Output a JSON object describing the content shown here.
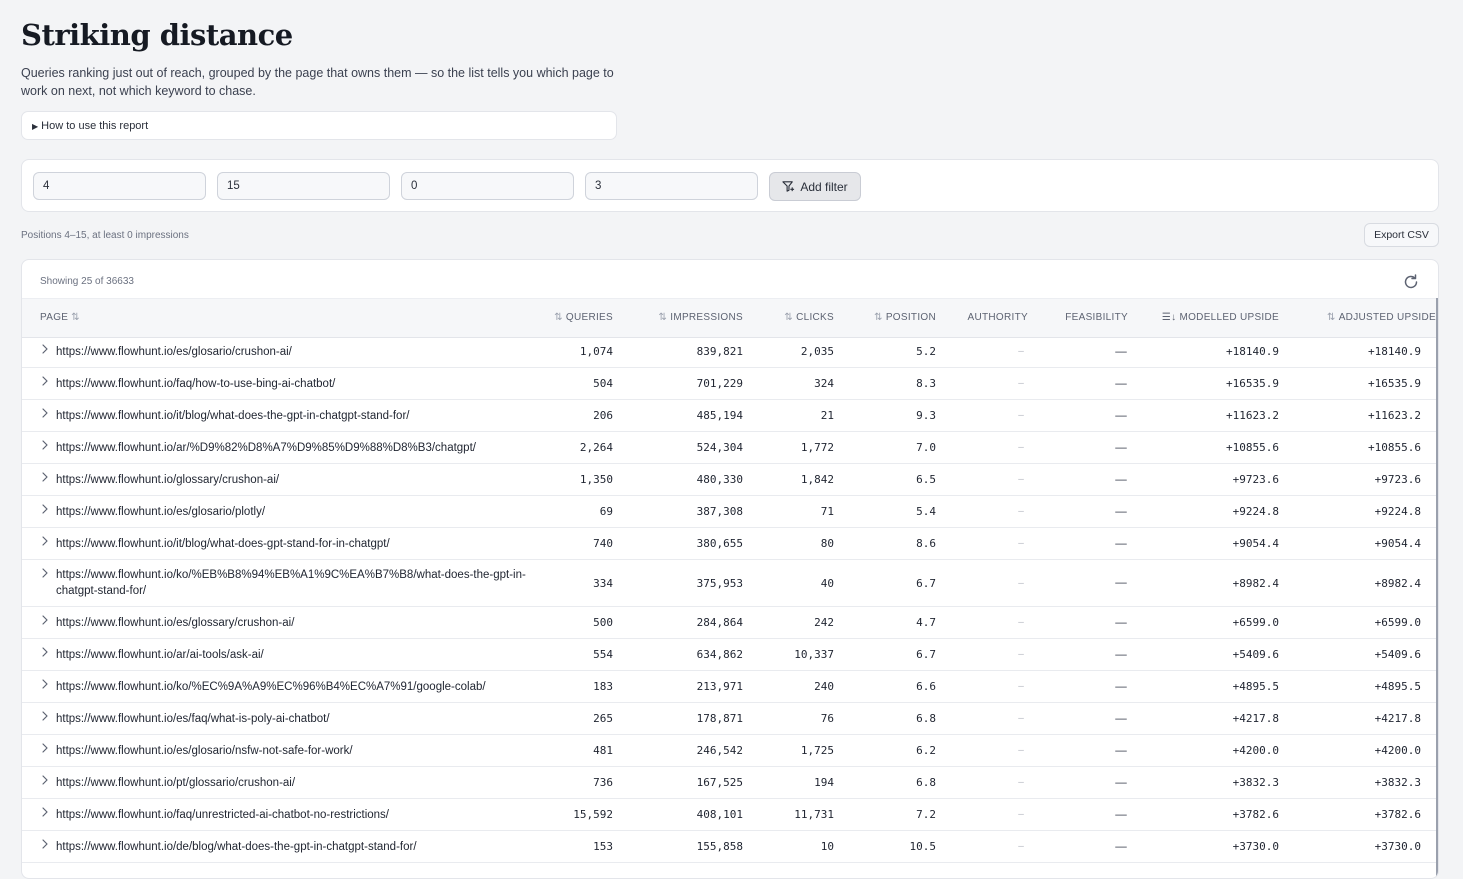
{
  "header": {
    "title": "Striking distance",
    "subtitle": "Queries ranking just out of reach, grouped by the page that owns them — so the list tells you which page to work on next, not which keyword to chase.",
    "howto_label": "How to use this report"
  },
  "filters": {
    "inputs": [
      "4",
      "15",
      "0",
      "3"
    ],
    "add_filter_label": "Add filter"
  },
  "caption": "Positions 4–15, at least 0 impressions",
  "export_label": "Export CSV",
  "table": {
    "showing": "Showing 25 of 36633",
    "columns": [
      "PAGE",
      "QUERIES",
      "IMPRESSIONS",
      "CLICKS",
      "POSITION",
      "AUTHORITY",
      "FEASIBILITY",
      "MODELLED UPSIDE",
      "ADJUSTED UPSIDE"
    ],
    "rows": [
      {
        "page": "https://www.flowhunt.io/es/glosario/crushon-ai/",
        "queries": "1,074",
        "impressions": "839,821",
        "clicks": "2,035",
        "position": "5.2",
        "authority": "–",
        "feasibility": "—",
        "modelled": "+18140.9",
        "adjusted": "+18140.9"
      },
      {
        "page": "https://www.flowhunt.io/faq/how-to-use-bing-ai-chatbot/",
        "queries": "504",
        "impressions": "701,229",
        "clicks": "324",
        "position": "8.3",
        "authority": "–",
        "feasibility": "—",
        "modelled": "+16535.9",
        "adjusted": "+16535.9"
      },
      {
        "page": "https://www.flowhunt.io/it/blog/what-does-the-gpt-in-chatgpt-stand-for/",
        "queries": "206",
        "impressions": "485,194",
        "clicks": "21",
        "position": "9.3",
        "authority": "–",
        "feasibility": "—",
        "modelled": "+11623.2",
        "adjusted": "+11623.2"
      },
      {
        "page": "https://www.flowhunt.io/ar/%D9%82%D8%A7%D9%85%D9%88%D8%B3/chatgpt/",
        "queries": "2,264",
        "impressions": "524,304",
        "clicks": "1,772",
        "position": "7.0",
        "authority": "–",
        "feasibility": "—",
        "modelled": "+10855.6",
        "adjusted": "+10855.6"
      },
      {
        "page": "https://www.flowhunt.io/glossary/crushon-ai/",
        "queries": "1,350",
        "impressions": "480,330",
        "clicks": "1,842",
        "position": "6.5",
        "authority": "–",
        "feasibility": "—",
        "modelled": "+9723.6",
        "adjusted": "+9723.6"
      },
      {
        "page": "https://www.flowhunt.io/es/glosario/plotly/",
        "queries": "69",
        "impressions": "387,308",
        "clicks": "71",
        "position": "5.4",
        "authority": "–",
        "feasibility": "—",
        "modelled": "+9224.8",
        "adjusted": "+9224.8"
      },
      {
        "page": "https://www.flowhunt.io/it/blog/what-does-gpt-stand-for-in-chatgpt/",
        "queries": "740",
        "impressions": "380,655",
        "clicks": "80",
        "position": "8.6",
        "authority": "–",
        "feasibility": "—",
        "modelled": "+9054.4",
        "adjusted": "+9054.4"
      },
      {
        "page": "https://www.flowhunt.io/ko/%EB%B8%94%EB%A1%9C%EA%B7%B8/what-does-the-gpt-in-chatgpt-stand-for/",
        "queries": "334",
        "impressions": "375,953",
        "clicks": "40",
        "position": "6.7",
        "authority": "–",
        "feasibility": "—",
        "modelled": "+8982.4",
        "adjusted": "+8982.4"
      },
      {
        "page": "https://www.flowhunt.io/es/glossary/crushon-ai/",
        "queries": "500",
        "impressions": "284,864",
        "clicks": "242",
        "position": "4.7",
        "authority": "–",
        "feasibility": "—",
        "modelled": "+6599.0",
        "adjusted": "+6599.0"
      },
      {
        "page": "https://www.flowhunt.io/ar/ai-tools/ask-ai/",
        "queries": "554",
        "impressions": "634,862",
        "clicks": "10,337",
        "position": "6.7",
        "authority": "–",
        "feasibility": "—",
        "modelled": "+5409.6",
        "adjusted": "+5409.6"
      },
      {
        "page": "https://www.flowhunt.io/ko/%EC%9A%A9%EC%96%B4%EC%A7%91/google-colab/",
        "queries": "183",
        "impressions": "213,971",
        "clicks": "240",
        "position": "6.6",
        "authority": "–",
        "feasibility": "—",
        "modelled": "+4895.5",
        "adjusted": "+4895.5"
      },
      {
        "page": "https://www.flowhunt.io/es/faq/what-is-poly-ai-chatbot/",
        "queries": "265",
        "impressions": "178,871",
        "clicks": "76",
        "position": "6.8",
        "authority": "–",
        "feasibility": "—",
        "modelled": "+4217.8",
        "adjusted": "+4217.8"
      },
      {
        "page": "https://www.flowhunt.io/es/glosario/nsfw-not-safe-for-work/",
        "queries": "481",
        "impressions": "246,542",
        "clicks": "1,725",
        "position": "6.2",
        "authority": "–",
        "feasibility": "—",
        "modelled": "+4200.0",
        "adjusted": "+4200.0"
      },
      {
        "page": "https://www.flowhunt.io/pt/glossario/crushon-ai/",
        "queries": "736",
        "impressions": "167,525",
        "clicks": "194",
        "position": "6.8",
        "authority": "–",
        "feasibility": "—",
        "modelled": "+3832.3",
        "adjusted": "+3832.3"
      },
      {
        "page": "https://www.flowhunt.io/faq/unrestricted-ai-chatbot-no-restrictions/",
        "queries": "15,592",
        "impressions": "408,101",
        "clicks": "11,731",
        "position": "7.2",
        "authority": "–",
        "feasibility": "—",
        "modelled": "+3782.6",
        "adjusted": "+3782.6"
      },
      {
        "page": "https://www.flowhunt.io/de/blog/what-does-the-gpt-in-chatgpt-stand-for/",
        "queries": "153",
        "impressions": "155,858",
        "clicks": "10",
        "position": "10.5",
        "authority": "–",
        "feasibility": "—",
        "modelled": "+3730.0",
        "adjusted": "+3730.0"
      }
    ]
  },
  "icons": {
    "add_filter": "filter-plus-icon",
    "refresh": "refresh-icon",
    "sort": "sort-arrows-icon",
    "sort_active": "sort-desc-icon",
    "expand": "chevron-right-icon"
  },
  "colors": {
    "background": "#f3f4f6",
    "card": "#ffffff",
    "header_bg": "#f6f7f9",
    "text": "#1f2430",
    "muted": "#6b7180"
  }
}
